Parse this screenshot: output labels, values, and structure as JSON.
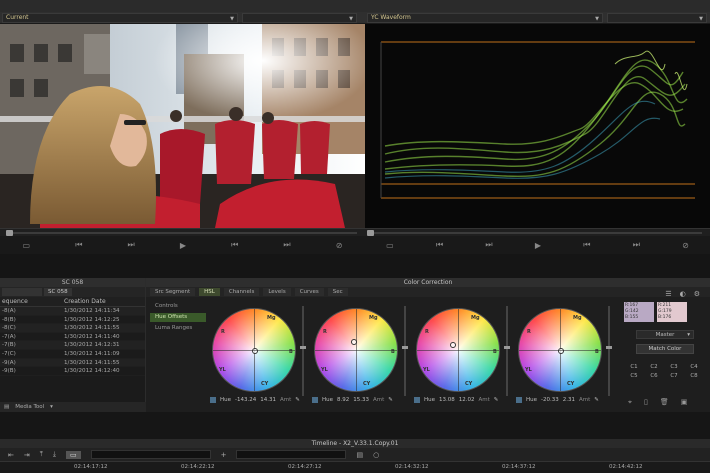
{
  "viewer_left": {
    "header": "Current",
    "transport": [
      "▭",
      "⏮",
      "⏭",
      "▶",
      "⏮",
      "⏭",
      "⊘"
    ]
  },
  "viewer_right": {
    "header": "YC Waveform",
    "transport": [
      "▭",
      "⏮",
      "⏭",
      "▶",
      "⏮",
      "⏭",
      "⊘"
    ]
  },
  "bin": {
    "title": "SC 058",
    "tabs": [
      "SC 058"
    ],
    "columns": [
      "equence",
      "Creation Date"
    ],
    "rows": [
      {
        "name": "-8(A)",
        "date": "1/30/2012 14:11:34"
      },
      {
        "name": "-8(B)",
        "date": "1/30/2012 14:12:25"
      },
      {
        "name": "-8(C)",
        "date": "1/30/2012 14:11:55"
      },
      {
        "name": "-7(A)",
        "date": "1/30/2012 14:11:40"
      },
      {
        "name": "-7(B)",
        "date": "1/30/2012 14:12:31"
      },
      {
        "name": "-7(C)",
        "date": "1/30/2012 14:11:09"
      },
      {
        "name": "-9(A)",
        "date": "1/30/2012 14:11:55"
      },
      {
        "name": "-9(B)",
        "date": "1/30/2012 14:12:40"
      }
    ],
    "footer": "Media Tool"
  },
  "color_correction": {
    "title": "Color Correction",
    "tabs": [
      "Src Segment",
      "HSL",
      "Channels",
      "Levels",
      "Curves",
      "Sec"
    ],
    "active_tab": "HSL",
    "side_items": [
      "Controls",
      "Hue Offsets",
      "Luma Ranges"
    ],
    "active_side": "Hue Offsets",
    "wheels": [
      {
        "label": "Hue",
        "v1": "-143.24",
        "v2": "14.31",
        "amt": "Amt"
      },
      {
        "label": "Hue",
        "v1": "8.92",
        "v2": "15.33",
        "amt": "Amt"
      },
      {
        "label": "Hue",
        "v1": "13.08",
        "v2": "12.02",
        "amt": "Amt"
      },
      {
        "label": "Hue",
        "v1": "-20.33",
        "v2": "2.31",
        "amt": "Amt"
      }
    ],
    "wheel_letters": [
      "R",
      "Mg",
      "B",
      "CY",
      "G",
      "YL"
    ],
    "swatch_a": "R:167\nG:142\nB:155",
    "swatch_b": "R:211\nG:179\nB:176",
    "master_label": "Master",
    "match_color": "Match Color",
    "channels": [
      "C1",
      "C2",
      "C3",
      "C4",
      "C5",
      "C6",
      "C7",
      "C8"
    ]
  },
  "timeline": {
    "title": "Timeline - X2_V.33.1.Copy.01",
    "ticks": [
      "02:14:17:12",
      "02:14:22:12",
      "02:14:27:12",
      "02:14:32:12",
      "02:14:37:12",
      "02:14:42:12"
    ]
  },
  "colors": {
    "header_text": "#d4c690",
    "active_tab": "#3e4a2e",
    "waveform": "#9ae64a"
  }
}
